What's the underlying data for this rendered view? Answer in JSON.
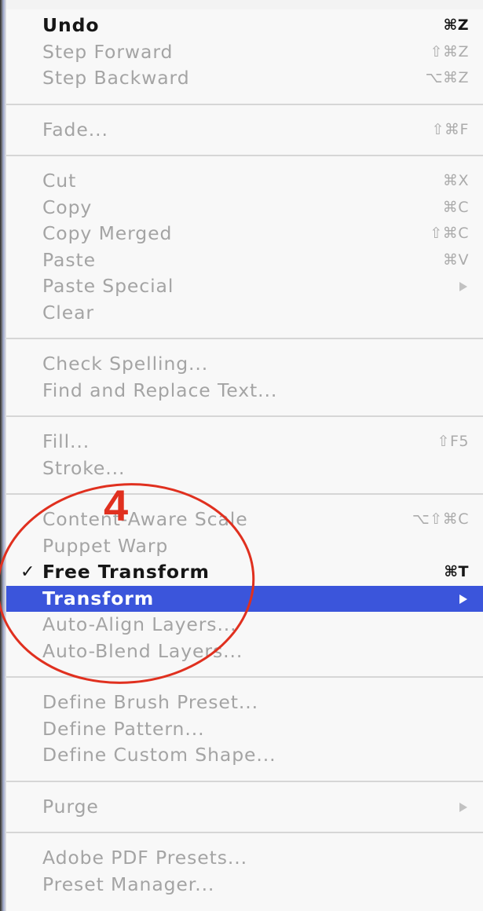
{
  "menu": {
    "groups": [
      {
        "items": [
          {
            "label": "Undo",
            "shortcut": "⌘Z",
            "enabled": true
          },
          {
            "label": "Step Forward",
            "shortcut": "⇧⌘Z"
          },
          {
            "label": "Step Backward",
            "shortcut": "⌥⌘Z"
          }
        ]
      },
      {
        "items": [
          {
            "label": "Fade...",
            "shortcut": "⇧⌘F"
          }
        ]
      },
      {
        "items": [
          {
            "label": "Cut",
            "shortcut": "⌘X"
          },
          {
            "label": "Copy",
            "shortcut": "⌘C"
          },
          {
            "label": "Copy Merged",
            "shortcut": "⇧⌘C"
          },
          {
            "label": "Paste",
            "shortcut": "⌘V"
          },
          {
            "label": "Paste Special",
            "submenu": true
          },
          {
            "label": "Clear"
          }
        ]
      },
      {
        "items": [
          {
            "label": "Check Spelling..."
          },
          {
            "label": "Find and Replace Text..."
          }
        ]
      },
      {
        "items": [
          {
            "label": "Fill...",
            "shortcut": "⇧F5"
          },
          {
            "label": "Stroke..."
          }
        ]
      },
      {
        "items": [
          {
            "label": "Content-Aware Scale",
            "shortcut": "⌥⇧⌘C"
          },
          {
            "label": "Puppet Warp"
          },
          {
            "label": "Free Transform",
            "shortcut": "⌘T",
            "enabled": true,
            "checked": true
          },
          {
            "label": "Transform",
            "submenu": true,
            "highlighted": true
          },
          {
            "label": "Auto-Align Layers..."
          },
          {
            "label": "Auto-Blend Layers..."
          }
        ]
      },
      {
        "items": [
          {
            "label": "Define Brush Preset..."
          },
          {
            "label": "Define Pattern..."
          },
          {
            "label": "Define Custom Shape..."
          }
        ]
      },
      {
        "items": [
          {
            "label": "Purge",
            "submenu": true
          }
        ]
      },
      {
        "items": [
          {
            "label": "Adobe PDF Presets..."
          },
          {
            "label": "Preset Manager..."
          }
        ]
      }
    ]
  },
  "annotation": {
    "step_number": "4",
    "color": "#e0301f"
  },
  "colors": {
    "highlight": "#3b55db",
    "enabled_text": "#161616",
    "disabled_text": "#a4a4a4",
    "separator": "#d6d6d6"
  }
}
